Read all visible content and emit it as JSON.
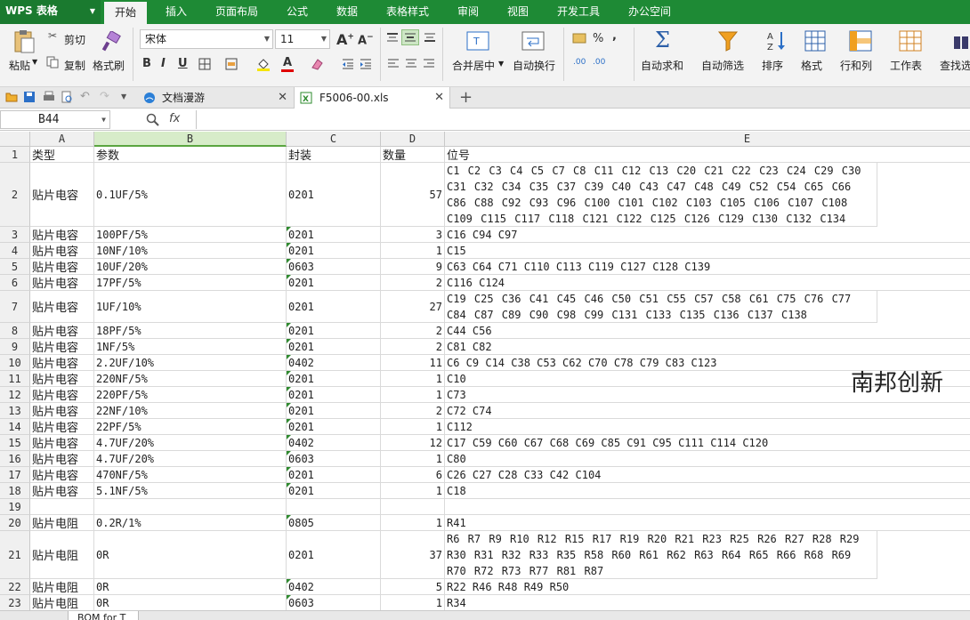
{
  "app": {
    "title": "WPS 表格"
  },
  "menu": [
    "开始",
    "插入",
    "页面布局",
    "公式",
    "数据",
    "表格样式",
    "审阅",
    "视图",
    "开发工具",
    "办公空间"
  ],
  "toolbar": {
    "paste": "粘贴",
    "cut": "剪切",
    "copy": "复制",
    "format_painter": "格式刷",
    "font_name": "宋体",
    "font_size": "11",
    "merge_center": "合并居中",
    "wrap_text": "自动换行",
    "autosum": "自动求和",
    "autofilter": "自动筛选",
    "sort": "排序",
    "format": "格式",
    "row_col": "行和列",
    "worksheet": "工作表",
    "find": "查找选"
  },
  "tabs": [
    {
      "label": "文档漫游"
    },
    {
      "label": "F5006-00.xls"
    }
  ],
  "formula_bar": {
    "cell_ref": "B44",
    "fx": "fx",
    "value": ""
  },
  "columns": [
    "A",
    "B",
    "C",
    "D",
    "E"
  ],
  "header_row": {
    "num": "1",
    "cells": [
      "类型",
      "参数",
      "封装",
      "数量",
      "位号"
    ]
  },
  "rows": [
    {
      "num": "2",
      "type": "贴片电容",
      "param": "0.1UF/5%",
      "pkg": "0201",
      "qty": "57",
      "ref": "C1 C2 C3 C4 C5 C7 C8 C11 C12 C13 C20 C21 C22 C23 C24 C29 C30 C31 C32 C34 C35 C37 C39 C40 C43 C47 C48 C49 C52 C54 C65 C66 C86 C88 C92 C93 C96 C100 C101 C102 C103 C105 C106 C107 C108 C109 C115 C117 C118 C121 C122 C125 C126 C129 C130 C132 C134"
    },
    {
      "num": "3",
      "type": "贴片电容",
      "param": "100PF/5%",
      "pkg": "0201",
      "qty": "3",
      "ref": "C16 C94 C97"
    },
    {
      "num": "4",
      "type": "贴片电容",
      "param": "10NF/10%",
      "pkg": "0201",
      "qty": "1",
      "ref": "C15"
    },
    {
      "num": "5",
      "type": "贴片电容",
      "param": "10UF/20%",
      "pkg": "0603",
      "qty": "9",
      "ref": "C63 C64 C71 C110 C113 C119 C127 C128 C139"
    },
    {
      "num": "6",
      "type": "贴片电容",
      "param": "17PF/5%",
      "pkg": "0201",
      "qty": "2",
      "ref": "C116 C124"
    },
    {
      "num": "7",
      "type": "贴片电容",
      "param": "1UF/10%",
      "pkg": "0201",
      "qty": "27",
      "ref": "C19 C25 C36 C41 C45 C46 C50 C51 C55 C57 C58 C61 C75 C76 C77 C84 C87 C89 C90 C98 C99 C131 C133 C135 C136 C137 C138"
    },
    {
      "num": "8",
      "type": "贴片电容",
      "param": "18PF/5%",
      "pkg": "0201",
      "qty": "2",
      "ref": "C44 C56"
    },
    {
      "num": "9",
      "type": "贴片电容",
      "param": "1NF/5%",
      "pkg": "0201",
      "qty": "2",
      "ref": "C81 C82"
    },
    {
      "num": "10",
      "type": "贴片电容",
      "param": "2.2UF/10%",
      "pkg": "0402",
      "qty": "11",
      "ref": "C6 C9 C14 C38 C53 C62 C70 C78 C79 C83 C123"
    },
    {
      "num": "11",
      "type": "贴片电容",
      "param": "220NF/5%",
      "pkg": "0201",
      "qty": "1",
      "ref": "C10"
    },
    {
      "num": "12",
      "type": "贴片电容",
      "param": "220PF/5%",
      "pkg": "0201",
      "qty": "1",
      "ref": "C73"
    },
    {
      "num": "13",
      "type": "贴片电容",
      "param": "22NF/10%",
      "pkg": "0201",
      "qty": "2",
      "ref": "C72 C74"
    },
    {
      "num": "14",
      "type": "贴片电容",
      "param": "22PF/5%",
      "pkg": "0201",
      "qty": "1",
      "ref": "C112"
    },
    {
      "num": "15",
      "type": "贴片电容",
      "param": "4.7UF/20%",
      "pkg": "0402",
      "qty": "12",
      "ref": "C17 C59 C60 C67 C68 C69 C85 C91 C95 C111 C114 C120"
    },
    {
      "num": "16",
      "type": "贴片电容",
      "param": "4.7UF/20%",
      "pkg": "0603",
      "qty": "1",
      "ref": "C80"
    },
    {
      "num": "17",
      "type": "贴片电容",
      "param": "470NF/5%",
      "pkg": "0201",
      "qty": "6",
      "ref": "C26 C27 C28 C33 C42 C104"
    },
    {
      "num": "18",
      "type": "贴片电容",
      "param": "5.1NF/5%",
      "pkg": "0201",
      "qty": "1",
      "ref": "C18"
    },
    {
      "num": "19",
      "type": "",
      "param": "",
      "pkg": "",
      "qty": "",
      "ref": ""
    },
    {
      "num": "20",
      "type": "贴片电阻",
      "param": "0.2R/1%",
      "pkg": "0805",
      "qty": "1",
      "ref": "R41"
    },
    {
      "num": "21",
      "type": "贴片电阻",
      "param": "0R",
      "pkg": "0201",
      "qty": "37",
      "ref": "R6 R7 R9 R10 R12 R15 R17 R19 R20 R21 R23 R25 R26 R27 R28 R29 R30 R31 R32 R33 R35 R58 R60 R61 R62 R63 R64 R65 R66 R68 R69 R70 R72 R73 R77 R81 R87"
    },
    {
      "num": "22",
      "type": "贴片电阻",
      "param": "0R",
      "pkg": "0402",
      "qty": "5",
      "ref": "R22 R46 R48 R49 R50"
    },
    {
      "num": "23",
      "type": "贴片电阻",
      "param": "0R",
      "pkg": "0603",
      "qty": "1",
      "ref": "R34"
    }
  ],
  "watermark": "南邦创新",
  "sheet_tab": "BOM for T"
}
